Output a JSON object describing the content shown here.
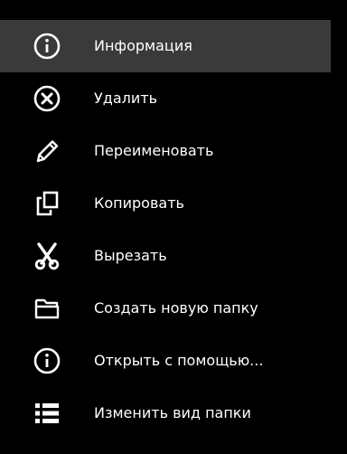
{
  "menu": {
    "items": [
      {
        "label": "Информация",
        "icon": "info-icon",
        "highlighted": true
      },
      {
        "label": "Удалить",
        "icon": "close-circle-icon"
      },
      {
        "label": "Переименовать",
        "icon": "pencil-icon"
      },
      {
        "label": "Копировать",
        "icon": "copy-icon"
      },
      {
        "label": "Вырезать",
        "icon": "scissors-icon"
      },
      {
        "label": "Создать новую папку",
        "icon": "folder-open-icon"
      },
      {
        "label": "Открыть с помощью...",
        "icon": "info-icon"
      },
      {
        "label": "Изменить вид папки",
        "icon": "list-view-icon"
      }
    ]
  },
  "colors": {
    "background": "#000000",
    "highlight": "#3a3a3a",
    "text": "#ffffff"
  }
}
